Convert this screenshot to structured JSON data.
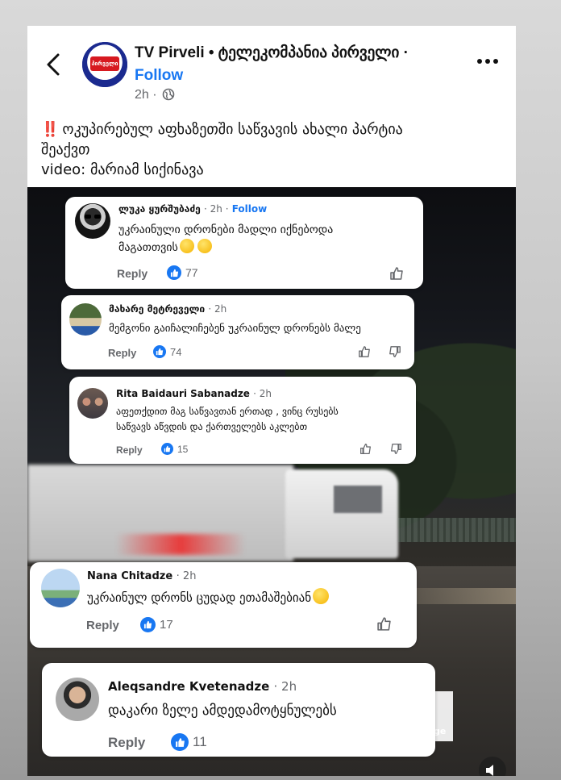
{
  "post": {
    "page_name": "TV Pirveli • ტელეკომპანია პირველი ·",
    "follow_label": "Follow",
    "time": "2h ·",
    "logo_text": "პირველი",
    "alert": "‼️",
    "text_line1": "ოკუპირებულ აფხაზეთში საწვავის ახალი პარტია",
    "text_line2": "შეაქვთ",
    "text_line3": "video: მარიამ სიქინავა"
  },
  "video": {
    "brand_tag": "ge"
  },
  "comments": [
    {
      "author": "ლუკა ყურშუბაძე",
      "time": "· 2h ·",
      "follow": "Follow",
      "text_line1": "უკრაინული დრონები მადლი იქნებოდა",
      "text_line2": "მაგათთვის",
      "reply_label": "Reply",
      "likes": "77"
    },
    {
      "author": "მახარე მეტრეველი",
      "time": "· 2h",
      "text_line1": "მემგონი გაიჩალიჩებენ უკრაინულ დრონებს მალე",
      "reply_label": "Reply",
      "likes": "74"
    },
    {
      "author": "Rita Baidauri Sabanadze",
      "time": "· 2h",
      "text_line1": "აფეთქდით მაგ საწვავთან ერთად , ვინც რუსებს",
      "text_line2": "საწვავს აწვდის და ქართველებს აკლებთ",
      "reply_label": "Reply",
      "likes": "15"
    },
    {
      "author": "Nana Chitadze",
      "time": "· 2h",
      "text_line1": "უკრაინულ დრონს ცუდად ეთამაშებიან",
      "reply_label": "Reply",
      "likes": "17"
    },
    {
      "author": "Aleqsandre Kvetenadze",
      "time": "· 2h",
      "text_line1": "დაკარი ზელე ამდედამოტყნულებს",
      "reply_label": "Reply",
      "likes": "11"
    }
  ],
  "colors": {
    "accent": "#1877f2",
    "alert_red": "#e41e26",
    "meta_gray": "#65676b"
  }
}
